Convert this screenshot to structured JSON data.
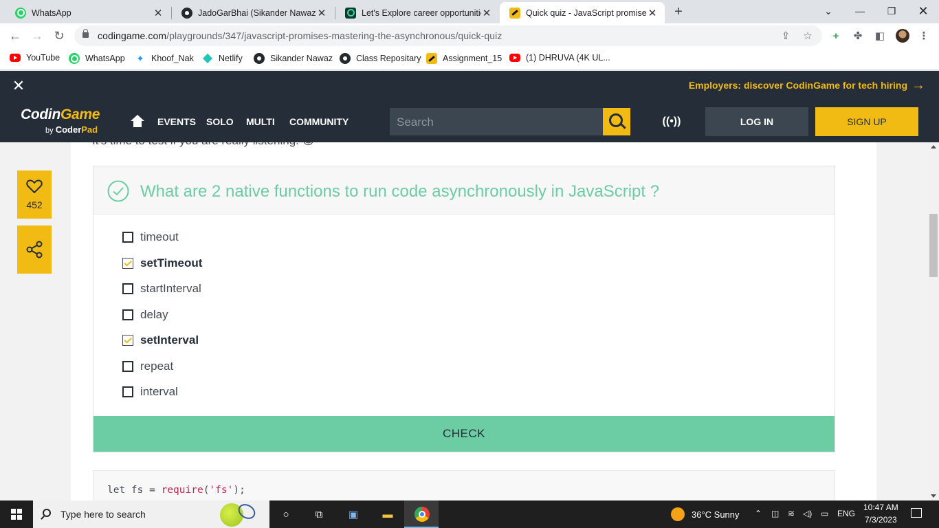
{
  "browser": {
    "tabs": [
      {
        "title": "WhatsApp",
        "icon": "whatsapp-icon"
      },
      {
        "title": "JadoGarBhai (Sikander Nawaz)",
        "icon": "github-icon"
      },
      {
        "title": "Let's Explore career opportunities",
        "icon": "turing-icon"
      },
      {
        "title": "Quick quiz - JavaScript promises",
        "icon": "codingame-icon",
        "active": true
      }
    ],
    "url_host": "codingame.com",
    "url_path": "/playgrounds/347/javascript-promises-mastering-the-asynchronous/quick-quiz",
    "bookmarks": [
      {
        "label": "YouTube",
        "icon": "youtube-icon"
      },
      {
        "label": "WhatsApp",
        "icon": "whatsapp-icon"
      },
      {
        "label": "Khoof_Nak",
        "icon": "twitter-icon"
      },
      {
        "label": "Netlify",
        "icon": "netlify-icon"
      },
      {
        "label": "Sikander Nawaz",
        "icon": "github-icon"
      },
      {
        "label": "Class Repositary",
        "icon": "github-icon"
      },
      {
        "label": "Assignment_15",
        "icon": "codingame-icon"
      },
      {
        "label": "(1) DHRUVA (4K UL...",
        "icon": "youtube-icon"
      }
    ]
  },
  "site": {
    "promo_text": "Employers: discover CodinGame for tech hiring",
    "logo_main_a": "Codin",
    "logo_main_b": "Game",
    "logo_by": "by",
    "logo_coder": "Coder",
    "logo_pad": "Pad",
    "nav": [
      "EVENTS",
      "SOLO",
      "MULTI",
      "COMMUNITY"
    ],
    "search_placeholder": "Search",
    "login_label": "LOG IN",
    "signup_label": "SIGN UP"
  },
  "content": {
    "intro_cut": "It's time to test if you are really listening. 😉",
    "likes": "452",
    "quiz": {
      "question": "What are 2 native functions to run code asynchronously in JavaScript ?",
      "options": [
        {
          "label": "timeout",
          "checked": false
        },
        {
          "label": "setTimeout",
          "checked": true
        },
        {
          "label": "startInterval",
          "checked": false
        },
        {
          "label": "delay",
          "checked": false
        },
        {
          "label": "setInterval",
          "checked": true
        },
        {
          "label": "repeat",
          "checked": false
        },
        {
          "label": "interval",
          "checked": false
        }
      ],
      "check_label": "CHECK"
    },
    "code": {
      "kw": "let fs = ",
      "fn": "require",
      "open": "(",
      "str": "'fs'",
      "close": ");"
    }
  },
  "taskbar": {
    "search_placeholder": "Type here to search",
    "weather": "36°C  Sunny",
    "lang": "ENG",
    "time": "10:47 AM",
    "date": "7/3/2023"
  },
  "colors": {
    "brand_yellow": "#f2bb13",
    "nav_dark": "#252e38",
    "quiz_green": "#6ccca3"
  }
}
